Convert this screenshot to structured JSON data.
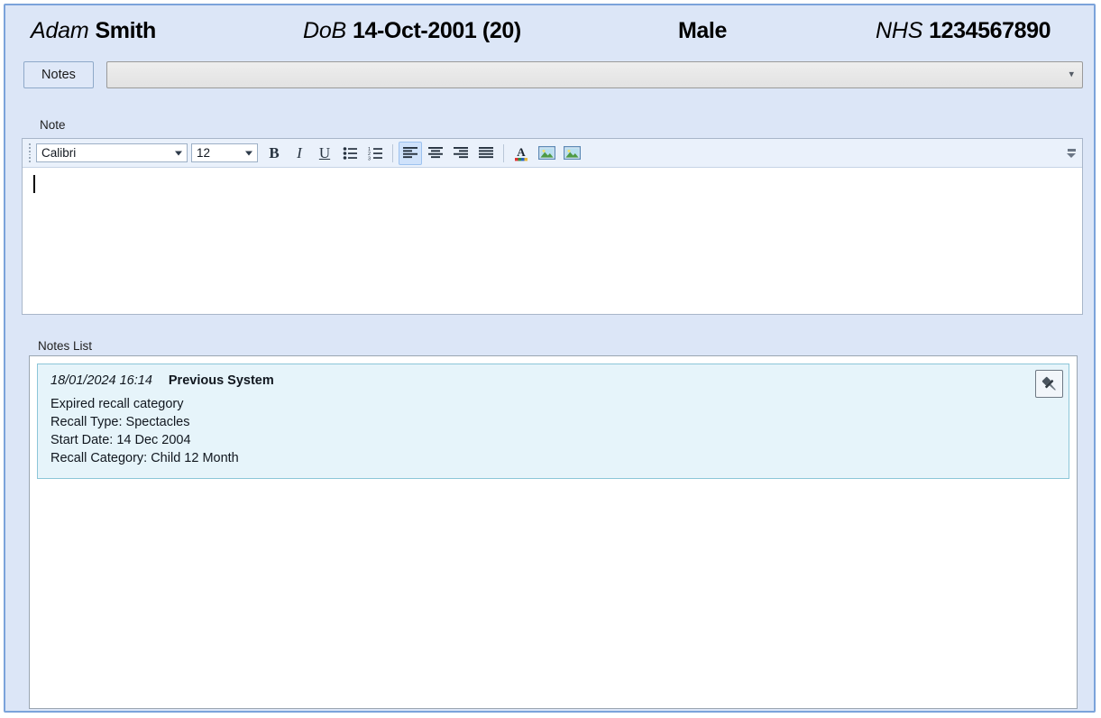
{
  "patient": {
    "first_name": "Adam",
    "last_name": "Smith",
    "dob_label": "DoB",
    "dob_value": "14-Oct-2001 (20)",
    "gender": "Male",
    "nhs_label": "NHS",
    "nhs_number": "1234567890"
  },
  "tabs": {
    "notes_tab_label": "Notes"
  },
  "combo": {
    "value": "",
    "placeholder": "",
    "chevron_icon": "chevron-down-icon"
  },
  "note_section": {
    "label": "Note",
    "editor_value": "",
    "toolbar": {
      "font_family": "Calibri",
      "font_size": "12",
      "bold_label": "B",
      "italic_label": "I",
      "underline_label": "U",
      "bullet_list_name": "bullet-list-icon",
      "numbered_list_name": "numbered-list-icon",
      "align_left_name": "align-left-icon",
      "align_center_name": "align-center-icon",
      "align_right_name": "align-right-icon",
      "align_justify_name": "align-justify-icon",
      "font_color_label": "A",
      "image_1_name": "insert-image-icon",
      "image_2_name": "insert-picture-icon",
      "overflow_name": "toolbar-overflow-icon",
      "active_button": "align-left-icon"
    }
  },
  "notes_list": {
    "label": "Notes List",
    "items": [
      {
        "timestamp": "18/01/2024 16:14",
        "author": "Previous System",
        "lines": [
          "Expired recall category",
          "Recall Type: Spectacles",
          "Start Date: 14 Dec 2004",
          "Recall Category: Child 12 Month"
        ],
        "pin_icon": "pin-icon"
      }
    ]
  },
  "colors": {
    "window_border": "#7ba3da",
    "background": "#dce6f7",
    "note_card_bg": "#e6f4fa",
    "note_card_border": "#8cc6d8",
    "toolbar_bg": "#eaf1fb",
    "active_button_bg": "#cfe2fb"
  }
}
